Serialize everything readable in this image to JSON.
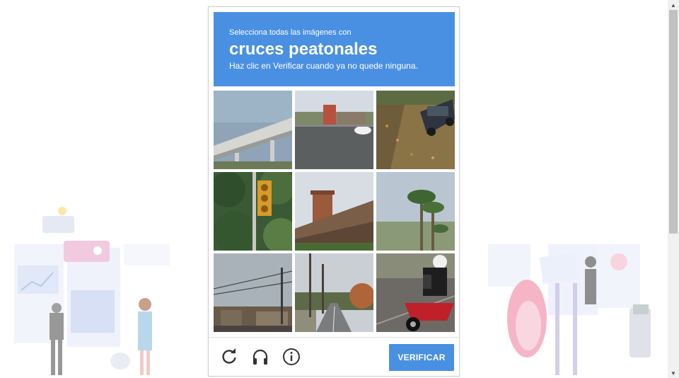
{
  "challenge": {
    "instruction_prefix": "Selecciona todas las imágenes con",
    "target": "cruces peatonales",
    "instruction_suffix": "Haz clic en Verificar cuando ya no quede ninguna."
  },
  "tiles": [
    {
      "subject": "highway overpass"
    },
    {
      "subject": "parking lot with car"
    },
    {
      "subject": "parked dark SUV on leaves"
    },
    {
      "subject": "traffic light among trees"
    },
    {
      "subject": "brick chimney and roof"
    },
    {
      "subject": "palm trees"
    },
    {
      "subject": "power lines over buildings"
    },
    {
      "subject": "road with utility poles"
    },
    {
      "subject": "motorcyclist"
    }
  ],
  "controls": {
    "reload_icon": "reload-icon",
    "audio_icon": "headphones-icon",
    "info_icon": "info-icon",
    "verify_label": "VERIFICAR"
  },
  "colors": {
    "accent": "#4a90e2",
    "header_text": "#ffffff"
  }
}
